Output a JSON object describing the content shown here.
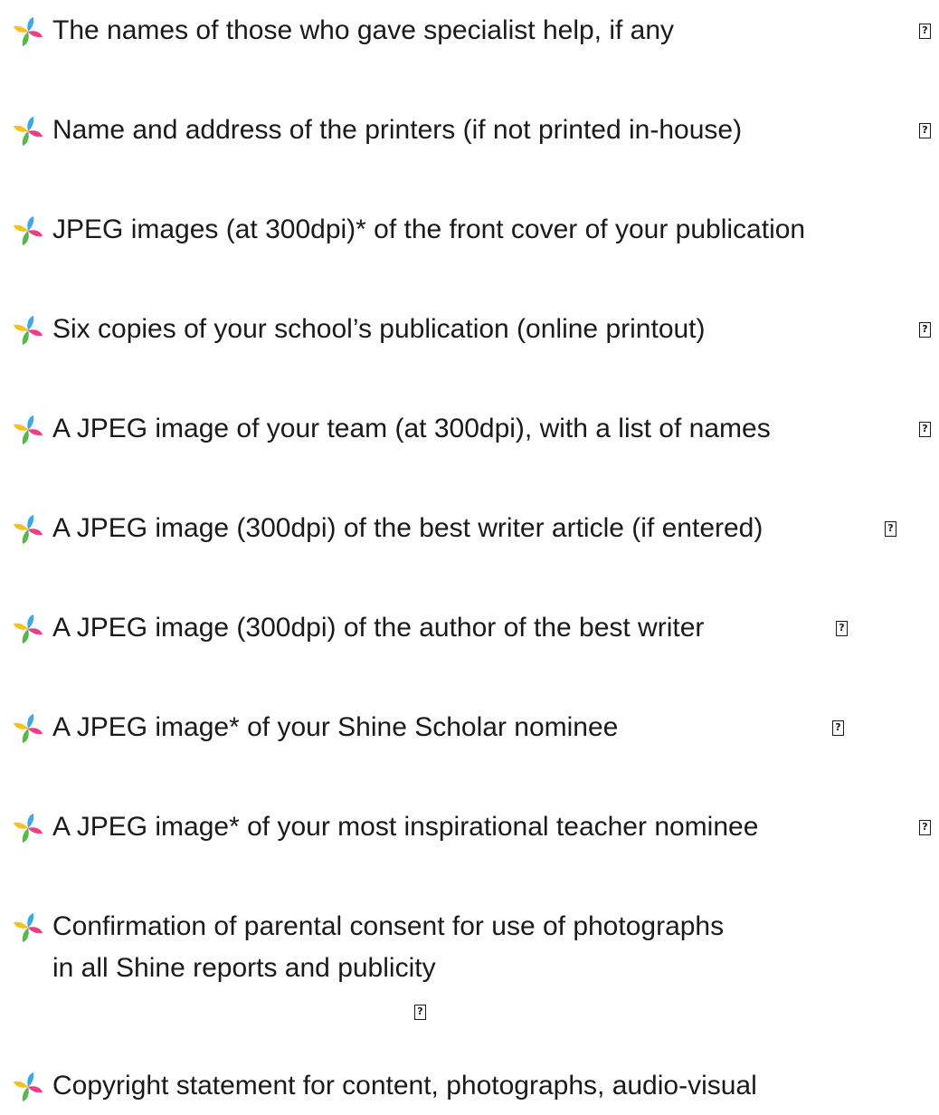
{
  "icons": {
    "bullet": "pinwheel-bullet-icon",
    "checkbox": "checkbox-icon"
  },
  "colors": {
    "bullet_blue": "#3fa6e8",
    "bullet_pink": "#ea3f8a",
    "bullet_yellow": "#f2c31b",
    "bullet_green": "#56b84a",
    "text": "#1a1a1a"
  },
  "checklist": {
    "box_glyph": "?",
    "items": [
      {
        "text": "The names of those who gave specialist help, if any"
      },
      {
        "text": "Name and address of the printers (if not printed in-house)"
      },
      {
        "text": "JPEG images (at 300dpi)* of the front cover of your publication"
      },
      {
        "text": "Six copies of your school’s publication  (online printout)"
      },
      {
        "text": "A JPEG image of your team (at 300dpi), with a list of names"
      },
      {
        "text": "A JPEG image (300dpi) of the best writer article (if entered)"
      },
      {
        "text": "A JPEG image (300dpi) of the author of the best writer"
      },
      {
        "text": "A JPEG image* of your Shine Scholar nominee"
      },
      {
        "text": "A JPEG image* of your most inspirational teacher nominee"
      },
      {
        "text": "Confirmation of parental consent for use of photographs",
        "text2": "in all Shine reports and publicity"
      },
      {
        "text": "Copyright statement for content, photographs, audio-visual"
      }
    ]
  }
}
